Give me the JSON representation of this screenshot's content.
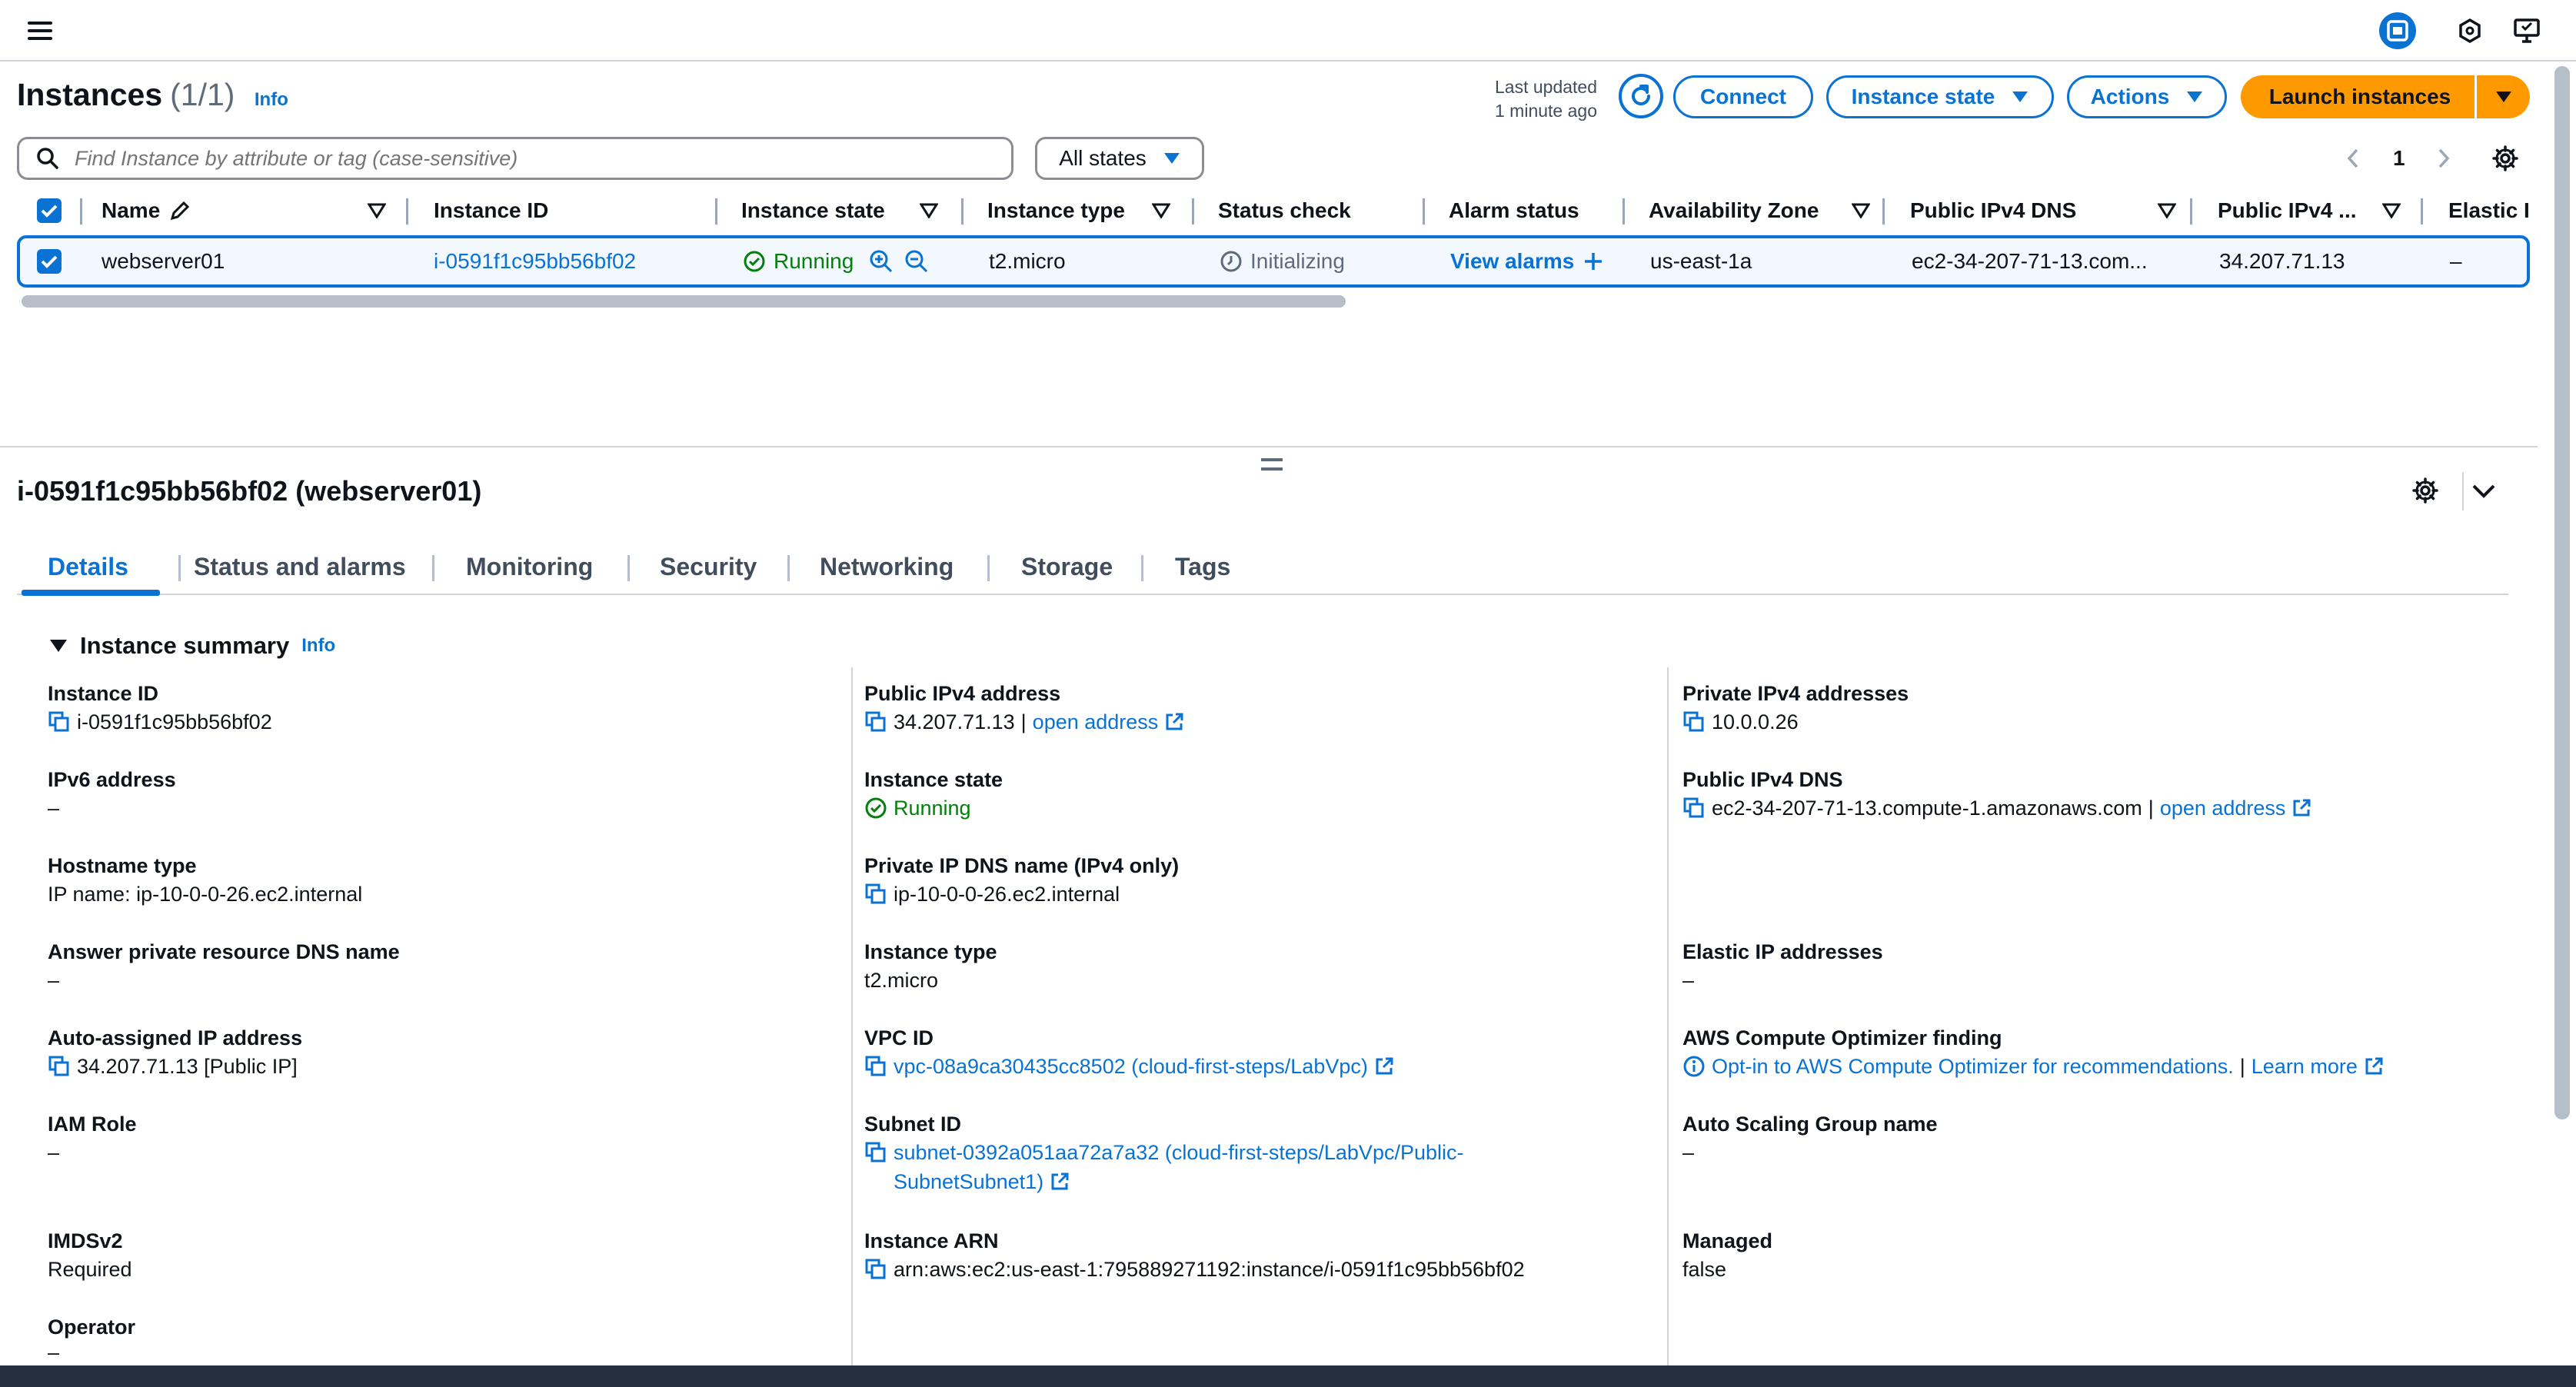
{
  "header": {
    "title": "Instances",
    "count": "(1/1)",
    "info": "Info",
    "last_updated_1": "Last updated",
    "last_updated_2": "1 minute ago",
    "connect": "Connect",
    "instance_state": "Instance state",
    "actions": "Actions",
    "launch": "Launch instances"
  },
  "search": {
    "placeholder": "Find Instance by attribute or tag (case-sensitive)"
  },
  "filter": {
    "states": "All states"
  },
  "pagination": {
    "page": "1"
  },
  "table": {
    "columns": [
      "Name",
      "Instance ID",
      "Instance state",
      "Instance type",
      "Status check",
      "Alarm status",
      "Availability Zone",
      "Public IPv4 DNS",
      "Public IPv4 ...",
      "Elastic I"
    ],
    "row": {
      "name": "webserver01",
      "instance_id": "i-0591f1c95bb56bf02",
      "state": "Running",
      "type": "t2.micro",
      "status_check": "Initializing",
      "alarm": "View alarms",
      "az": "us-east-1a",
      "dns": "ec2-34-207-71-13.com...",
      "ipv4": "34.207.71.13",
      "elastic": "–"
    }
  },
  "detail": {
    "title": "i-0591f1c95bb56bf02 (webserver01)",
    "tabs": [
      "Details",
      "Status and alarms",
      "Monitoring",
      "Security",
      "Networking",
      "Storage",
      "Tags"
    ],
    "summary": "Instance summary",
    "info": "Info",
    "col1": {
      "instance_id_label": "Instance ID",
      "instance_id": "i-0591f1c95bb56bf02",
      "ipv6_label": "IPv6 address",
      "ipv6": "–",
      "hostname_label": "Hostname type",
      "hostname": "IP name: ip-10-0-0-26.ec2.internal",
      "answer_label": "Answer private resource DNS name",
      "answer": "–",
      "autoip_label": "Auto-assigned IP address",
      "autoip": "34.207.71.13 [Public IP]",
      "iam_label": "IAM Role",
      "iam": "–",
      "imds_label": "IMDSv2",
      "imds": "Required",
      "operator_label": "Operator",
      "operator": "–"
    },
    "col2": {
      "pubip_label": "Public IPv4 address",
      "pubip": "34.207.71.13",
      "pipe": "|",
      "open_address": "open address",
      "state_label": "Instance state",
      "state": "Running",
      "privdns_label": "Private IP DNS name (IPv4 only)",
      "privdns": "ip-10-0-0-26.ec2.internal",
      "type_label": "Instance type",
      "type": "t2.micro",
      "vpc_label": "VPC ID",
      "vpc": "vpc-08a9ca30435cc8502 (cloud-first-steps/LabVpc)",
      "subnet_label": "Subnet ID",
      "subnet_1": "subnet-0392a051aa72a7a32 (cloud-first-steps/LabVpc/Public-",
      "subnet_2": "SubnetSubnet1)",
      "arn_label": "Instance ARN",
      "arn": "arn:aws:ec2:us-east-1:795889271192:instance/i-0591f1c95bb56bf02"
    },
    "col3": {
      "privip_label": "Private IPv4 addresses",
      "privip": "10.0.0.26",
      "pubdns_label": "Public IPv4 DNS",
      "pubdns": "ec2-34-207-71-13.compute-1.amazonaws.com",
      "pipe": "|",
      "open_address": "open address",
      "eip_label": "Elastic IP addresses",
      "eip": "–",
      "optimizer_label": "AWS Compute Optimizer finding",
      "optimizer": "Opt-in to AWS Compute Optimizer for recommendations.",
      "pipe2": "|",
      "learn_more": "Learn more",
      "asg_label": "Auto Scaling Group name",
      "asg": "–",
      "managed_label": "Managed",
      "managed": "false"
    }
  },
  "colors": {
    "accent": "#0972d3",
    "orange": "#ff9900",
    "success": "#037f0c"
  }
}
